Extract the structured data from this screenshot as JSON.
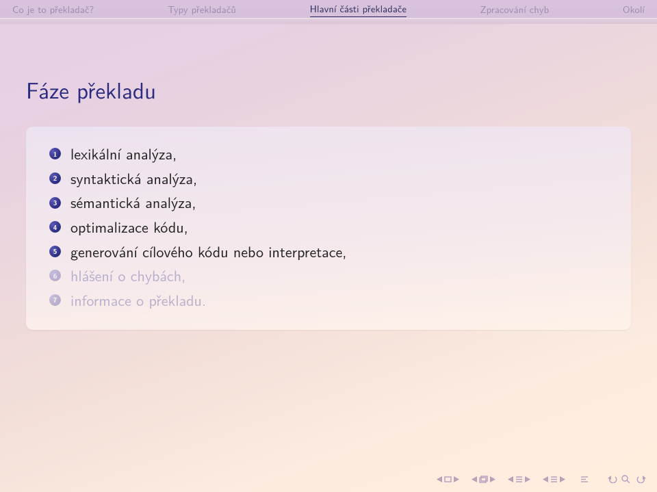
{
  "nav": {
    "items": [
      {
        "label": "Co je to překladač?",
        "active": false
      },
      {
        "label": "Typy překladačů",
        "active": false
      },
      {
        "label": "Hlavní části překladače",
        "active": true
      },
      {
        "label": "Zpracování chyb",
        "active": false
      },
      {
        "label": "Okolí",
        "active": false
      }
    ]
  },
  "title": "Fáze překladu",
  "items": [
    {
      "n": "1",
      "text": "lexikální analýza,",
      "dim": false
    },
    {
      "n": "2",
      "text": "syntaktická analýza,",
      "dim": false
    },
    {
      "n": "3",
      "text": "sémantická analýza,",
      "dim": false
    },
    {
      "n": "4",
      "text": "optimalizace kódu,",
      "dim": false
    },
    {
      "n": "5",
      "text": "generování cílového kódu nebo interpretace,",
      "dim": false
    },
    {
      "n": "6",
      "text": "hlášení o chybách,",
      "dim": true
    },
    {
      "n": "7",
      "text": "informace o překladu.",
      "dim": true
    }
  ]
}
